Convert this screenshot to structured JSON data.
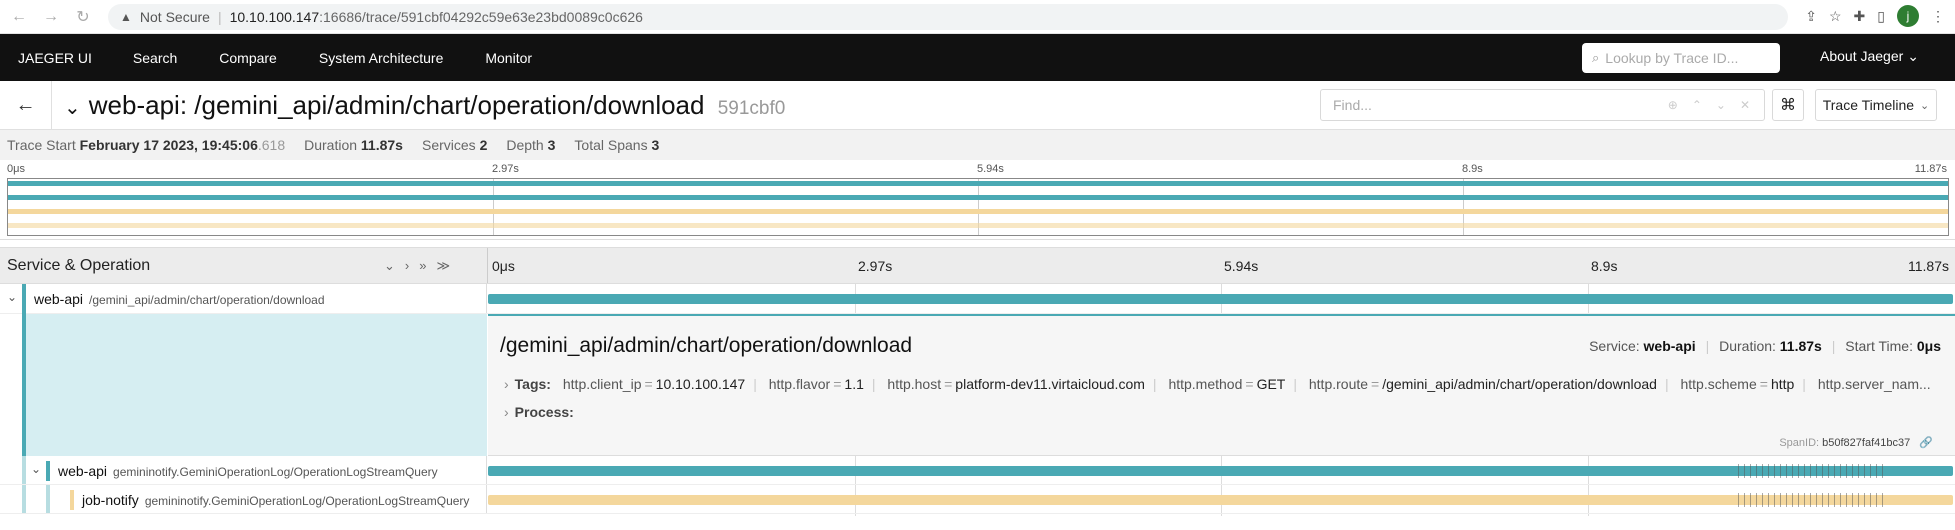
{
  "browser": {
    "security": "Not Secure",
    "url_host": "10.10.100.147",
    "url_path": ":16686/trace/591cbf04292c59e63e23bd0089c0c626",
    "avatar_letter": "j"
  },
  "nav": {
    "brand": "JAEGER UI",
    "items": [
      "Search",
      "Compare",
      "System Architecture",
      "Monitor"
    ],
    "lookup_placeholder": "Lookup by Trace ID...",
    "about": "About Jaeger"
  },
  "trace": {
    "title": "web-api: /gemini_api/admin/chart/operation/download",
    "trace_id_short": "591cbf0",
    "find_placeholder": "Find...",
    "cmd_symbol": "⌘",
    "view_select": "Trace Timeline"
  },
  "meta": {
    "trace_start_label": "Trace Start",
    "trace_start_date": "February 17 2023, 19:45:06",
    "trace_start_ms": ".618",
    "duration_label": "Duration",
    "duration": "11.87s",
    "services_label": "Services",
    "services": "2",
    "depth_label": "Depth",
    "depth": "3",
    "total_spans_label": "Total Spans",
    "total_spans": "3"
  },
  "ticks": [
    "0μs",
    "2.97s",
    "5.94s",
    "8.9s",
    "11.87s"
  ],
  "timeline_header": {
    "title": "Service & Operation"
  },
  "spans": [
    {
      "service": "web-api",
      "operation": "/gemini_api/admin/chart/operation/download"
    },
    {
      "service": "web-api",
      "operation": "gemininotify.GeminiOperationLog/OperationLogStreamQuery"
    },
    {
      "service": "job-notify",
      "operation": "gemininotify.GeminiOperationLog/OperationLogStreamQuery"
    }
  ],
  "detail": {
    "title": "/gemini_api/admin/chart/operation/download",
    "service_label": "Service:",
    "service": "web-api",
    "duration_label": "Duration:",
    "duration": "11.87s",
    "start_label": "Start Time:",
    "start": "0μs",
    "tags_label": "Tags:",
    "tags": [
      {
        "k": "http.client_ip",
        "v": "10.10.100.147"
      },
      {
        "k": "http.flavor",
        "v": "1.1"
      },
      {
        "k": "http.host",
        "v": "platform-dev11.virtaicloud.com"
      },
      {
        "k": "http.method",
        "v": "GET"
      },
      {
        "k": "http.route",
        "v": "/gemini_api/admin/chart/operation/download"
      },
      {
        "k": "http.scheme",
        "v": "http"
      },
      {
        "k": "http.server_nam...",
        "v": ""
      }
    ],
    "process_label": "Process:",
    "spanid_label": "SpanID:",
    "spanid": "b50f827faf41bc37"
  },
  "colors": {
    "web_api": "#4aa9b4",
    "job_notify": "#f4d79c"
  }
}
